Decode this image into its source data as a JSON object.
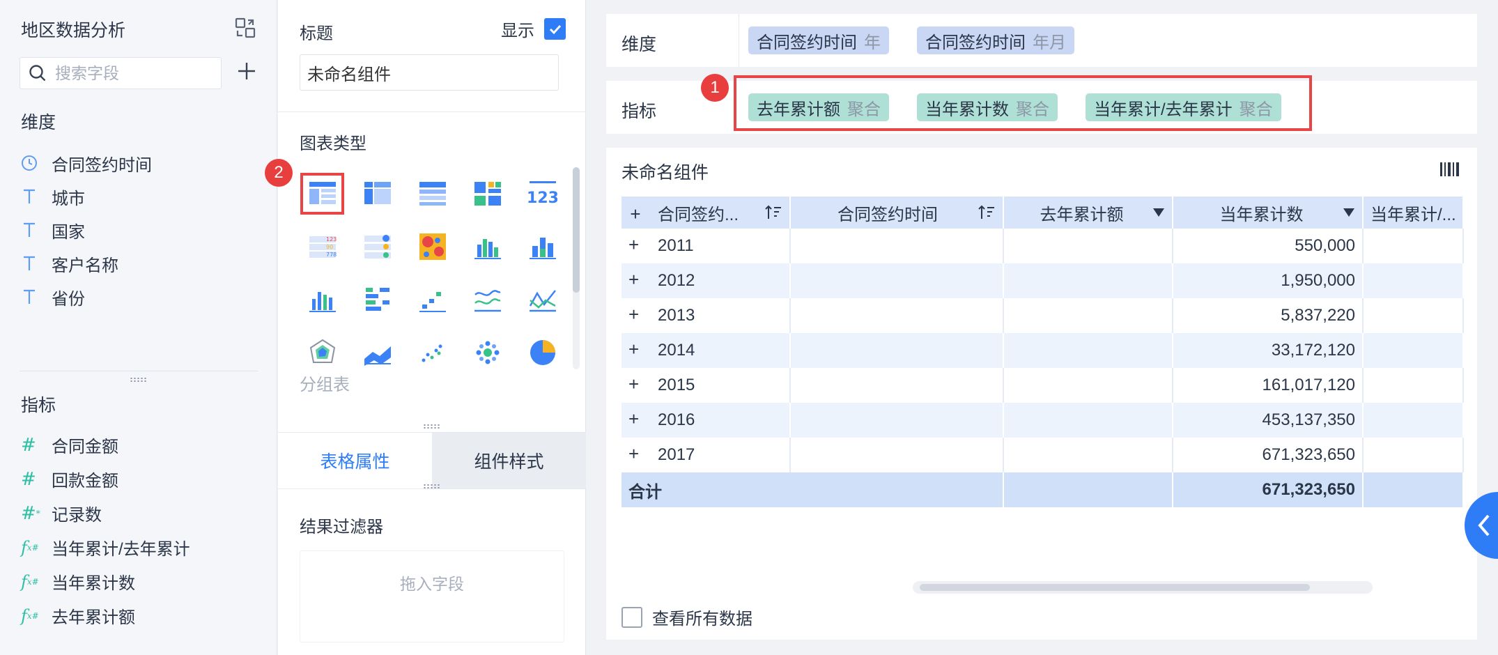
{
  "left_panel": {
    "title": "地区数据分析",
    "search_placeholder": "搜索字段",
    "dimension_label": "维度",
    "dimensions": [
      {
        "icon": "clock-icon",
        "label": "合同签约时间"
      },
      {
        "icon": "text-type-icon",
        "label": "城市"
      },
      {
        "icon": "text-type-icon",
        "label": "国家"
      },
      {
        "icon": "text-type-icon",
        "label": "客户名称"
      },
      {
        "icon": "text-type-icon",
        "label": "省份"
      }
    ],
    "metric_label": "指标",
    "metrics": [
      {
        "icon": "number-type-icon",
        "label": "合同金额"
      },
      {
        "icon": "number-type-icon",
        "label": "回款金额"
      },
      {
        "icon": "record-count-icon",
        "label": "记录数"
      },
      {
        "icon": "formula-icon",
        "label": "当年累计/去年累计"
      },
      {
        "icon": "formula-icon",
        "label": "当年累计数"
      },
      {
        "icon": "formula-icon",
        "label": "去年累计额"
      }
    ]
  },
  "middle_panel": {
    "title_label": "标题",
    "show_label": "显示",
    "title_value": "未命名组件",
    "chart_type_label": "图表类型",
    "selected_chart_caption": "分组表",
    "tabs": [
      "表格属性",
      "组件样式"
    ],
    "active_tab": 0,
    "result_filter_label": "结果过滤器",
    "drop_zone_text": "拖入字段",
    "badge_2": "2"
  },
  "shelves": {
    "dimension_label": "维度",
    "dimension_pills": [
      {
        "name": "合同签约时间",
        "agg": "年"
      },
      {
        "name": "合同签约时间",
        "agg": "年月"
      }
    ],
    "metric_label": "指标",
    "metric_pills": [
      {
        "name": "去年累计额",
        "agg": "聚合"
      },
      {
        "name": "当年累计数",
        "agg": "聚合"
      },
      {
        "name": "当年累计/去年累计",
        "agg": "聚合"
      }
    ],
    "badge_1": "1"
  },
  "widget": {
    "title": "未命名组件",
    "columns": [
      "合同签约...",
      "合同签约时间",
      "去年累计额",
      "当年累计数",
      "当年累计/..."
    ],
    "rows": [
      {
        "year": "2011",
        "current": "550,000"
      },
      {
        "year": "2012",
        "current": "1,950,000"
      },
      {
        "year": "2013",
        "current": "5,837,220"
      },
      {
        "year": "2014",
        "current": "33,172,120"
      },
      {
        "year": "2015",
        "current": "161,017,120"
      },
      {
        "year": "2016",
        "current": "453,137,350"
      },
      {
        "year": "2017",
        "current": "671,323,650"
      }
    ],
    "total_label": "合计",
    "total_current": "671,323,650",
    "view_all_label": "查看所有数据"
  },
  "colors": {
    "accent": "#2e7cf6",
    "highlight": "#e84646",
    "dimension_pill": "#c9d6f4",
    "metric_pill": "#aee0d6",
    "table_header": "#d7e4f9"
  }
}
